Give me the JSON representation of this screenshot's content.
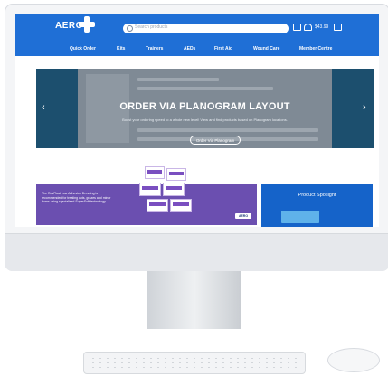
{
  "header": {
    "logo_text": "AERO",
    "search_placeholder": "Search products",
    "cart_total": "$43.99"
  },
  "nav": {
    "items": [
      "Quick Order",
      "Kits",
      "Trainers",
      "AEDs",
      "First Aid",
      "Wound Care",
      "Member Centre"
    ]
  },
  "banner": {
    "title": "ORDER VIA PLANOGRAM LAYOUT",
    "subtitle": "Boost your ordering speed to a whole new level! View and find products based on Planogram locations.",
    "button": "Order Via Planogram",
    "prev_icon": "chevron-left-icon",
    "next_icon": "chevron-right-icon"
  },
  "promo": {
    "text": "The RevPlast Low Adhesion Dressing is recommended for treating cuts, grazes and minor burns using specialised SuperSoft technology.",
    "badge": "AERO"
  },
  "spotlight": {
    "title": "Product Spotlight"
  },
  "colors": {
    "brand_blue": "#1f6fd6",
    "promo_purple": "#6b4fb0",
    "banner_dark": "#1c4f6e"
  }
}
